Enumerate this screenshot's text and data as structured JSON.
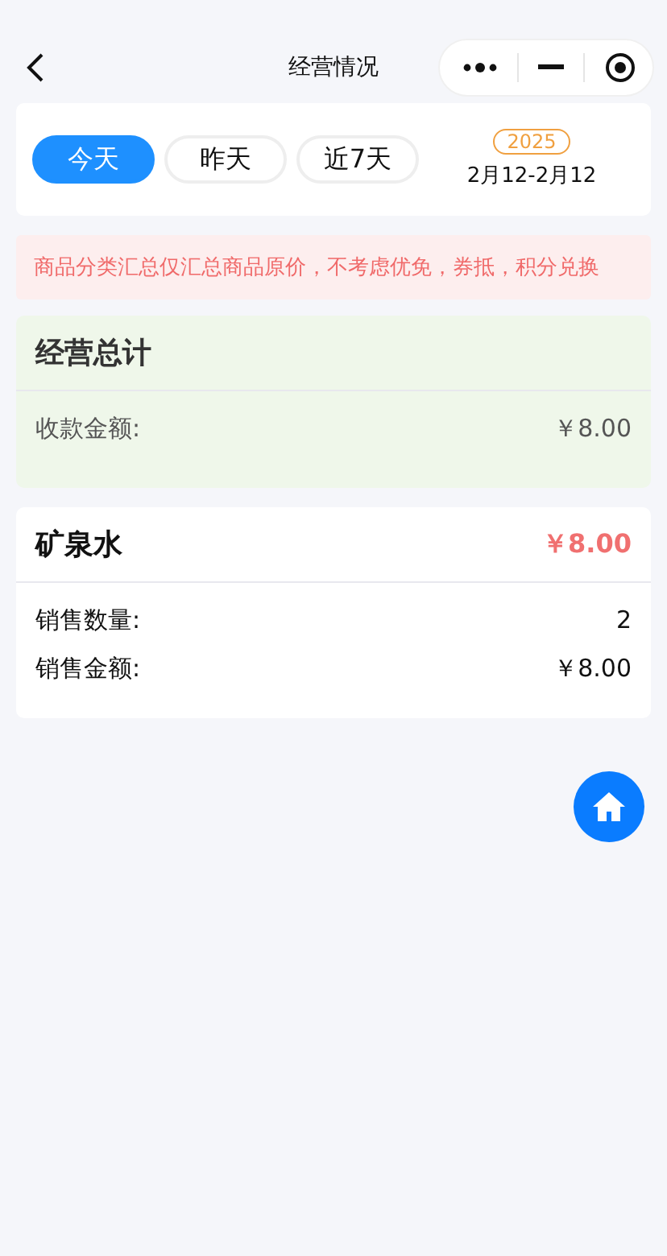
{
  "nav": {
    "title": "经营情况"
  },
  "tabs": [
    {
      "label": "今天",
      "selected": true
    },
    {
      "label": "昨天",
      "selected": false
    },
    {
      "label": "近7天",
      "selected": false
    }
  ],
  "date": {
    "year": "2025",
    "range": "2月12-2月12"
  },
  "notice": "商品分类汇总仅汇总商品原价，不考虑优免，券抵，积分兑换",
  "summary": {
    "title": "经营总计",
    "rows": [
      {
        "label": "收款金额:",
        "value": "￥8.00"
      }
    ]
  },
  "products": [
    {
      "name": "矿泉水",
      "total": "￥8.00",
      "rows": [
        {
          "label": "销售数量:",
          "value": "2"
        },
        {
          "label": "销售金额:",
          "value": "￥8.00"
        }
      ]
    }
  ]
}
